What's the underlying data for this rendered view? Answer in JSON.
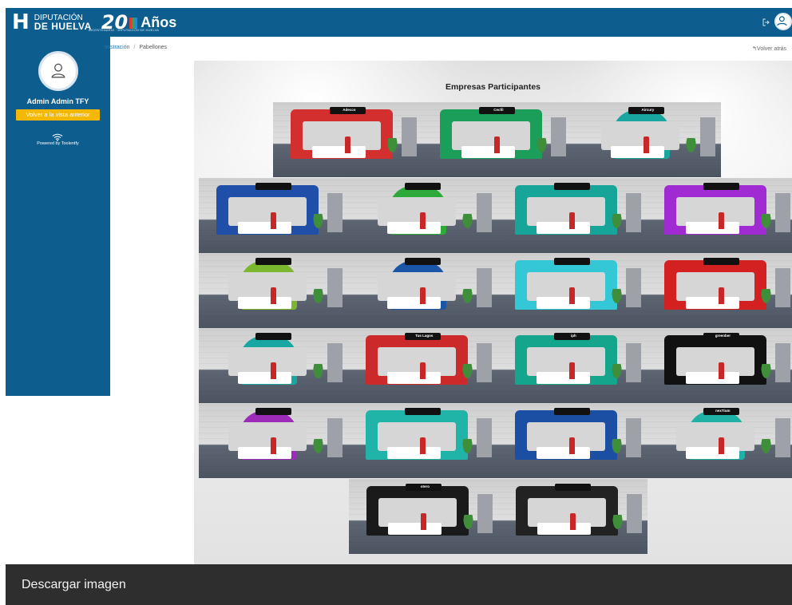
{
  "header": {
    "logo_letter": "H",
    "org_line1": "DIPUTACIÓN",
    "org_line2": "DE HUELVA",
    "anniversary_number": "20",
    "anniversary_word": "Años",
    "anniversary_sub": "BICENTENARIO · DIPUTACIÓN DE HUELVA",
    "brand_color": "#0d5e8e"
  },
  "sidebar": {
    "user_name": "Admin Admin TFY",
    "back_button": "Volver a la vista anterior",
    "powered_by": "Powered by Toolentfy",
    "button_color": "#f5b800"
  },
  "breadcrumb": {
    "parent": "inistración",
    "separator": "/",
    "current": "Pabellones"
  },
  "back_link": "Volver atrás",
  "canvas": {
    "title": "Empresas Participantes"
  },
  "booths": [
    {
      "color": "#d32f2f",
      "label": "Adecco",
      "style": "box"
    },
    {
      "color": "#1b9e5a",
      "label": "Cecfil",
      "style": "box"
    },
    {
      "color": "#1aa6a0",
      "label": "Aircury",
      "style": "arch"
    },
    {
      "color": "#1f4fa8",
      "label": "",
      "style": "box"
    },
    {
      "color": "#2eaa3b",
      "label": "",
      "style": "arch"
    },
    {
      "color": "#17a59a",
      "label": "",
      "style": "box"
    },
    {
      "color": "#a12bd3",
      "label": "",
      "style": "box"
    },
    {
      "color": "#7cb82f",
      "label": "",
      "style": "arch"
    },
    {
      "color": "#1a55a8",
      "label": "",
      "style": "arch"
    },
    {
      "color": "#34c7d6",
      "label": "",
      "style": "box"
    },
    {
      "color": "#d32020",
      "label": "",
      "style": "box"
    },
    {
      "color": "#18a7a2",
      "label": "",
      "style": "arch"
    },
    {
      "color": "#cc2a2a",
      "label": "Tus Lagos",
      "style": "box"
    },
    {
      "color": "#14a58c",
      "label": "iph",
      "style": "box"
    },
    {
      "color": "#111111",
      "label": "greenber",
      "style": "box"
    },
    {
      "color": "#9c2bb8",
      "label": "",
      "style": "arch"
    },
    {
      "color": "#20b3a8",
      "label": "",
      "style": "box"
    },
    {
      "color": "#1b4fa3",
      "label": "",
      "style": "box"
    },
    {
      "color": "#1fb0a6",
      "label": "nexTium",
      "style": "arch"
    },
    {
      "color": "#1a1a1a",
      "label": "otero",
      "style": "box"
    },
    {
      "color": "#222222",
      "label": "",
      "style": "box"
    }
  ],
  "footer": {
    "download_label": "Descargar imagen"
  }
}
